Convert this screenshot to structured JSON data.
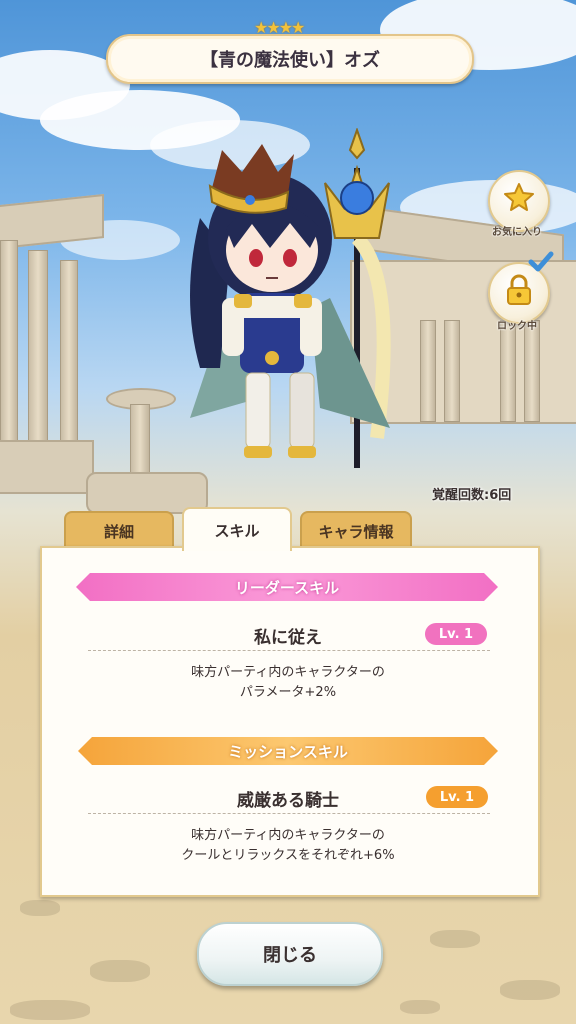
{
  "header": {
    "rarity_stars": "★★★★",
    "character_title": "【青の魔法使い】オズ"
  },
  "side_buttons": {
    "favorite_label": "お気に入り",
    "lock_label": "ロック中"
  },
  "awakening": "覚醒回数:6回",
  "tabs": [
    {
      "label": "詳細",
      "active": false
    },
    {
      "label": "スキル",
      "active": true
    },
    {
      "label": "キャラ情報",
      "active": false
    }
  ],
  "leader_skill": {
    "header": "リーダースキル",
    "name": "私に従え",
    "level": "Lv. 1",
    "description_line1": "味方パーティ内のキャラクターの",
    "description_line2": "パラメータ+2%"
  },
  "mission_skill": {
    "header": "ミッションスキル",
    "name": "威厳ある騎士",
    "level": "Lv. 1",
    "description_line1": "味方パーティ内のキャラクターの",
    "description_line2": "クールとリラックスをそれぞれ+6%"
  },
  "close_button": "閉じる",
  "colors": {
    "leader_accent": "#f26fc4",
    "mission_accent": "#f5a43a",
    "tab_inactive": "#e6b860",
    "panel_bg": "#fffdf8"
  },
  "icons": [
    "star-icon",
    "padlock-icon",
    "checkmark-icon"
  ]
}
